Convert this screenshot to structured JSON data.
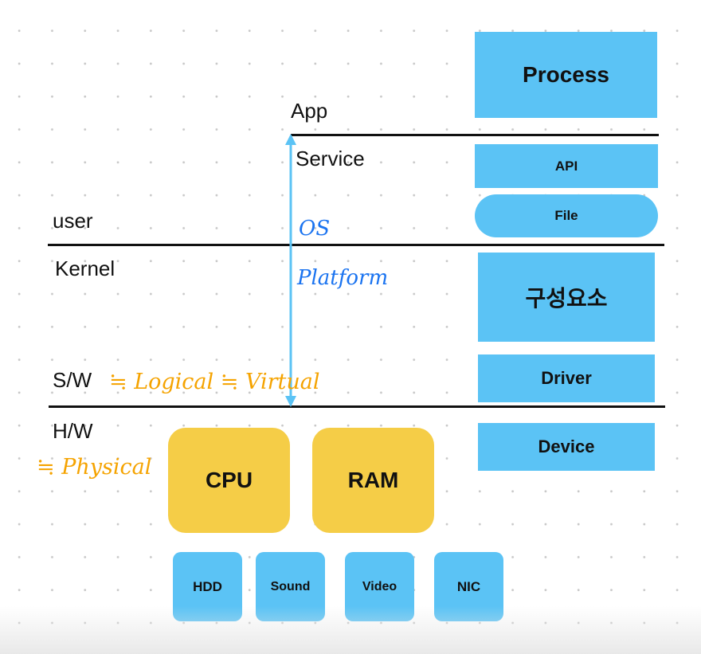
{
  "layers": {
    "app": "App",
    "service": "Service",
    "user": "user",
    "kernel": "Kernel",
    "sw": "S/W",
    "hw": "H/W"
  },
  "annotations": {
    "os": "OS",
    "platform": "Platform",
    "logical": "≒ Logical ≒ Virtual",
    "physical": "≒ Physical"
  },
  "stack": [
    "Process",
    "API",
    "File",
    "구성요소",
    "Driver",
    "Device"
  ],
  "hardware": {
    "main": [
      "CPU",
      "RAM"
    ],
    "devices": [
      "HDD",
      "Sound",
      "Video",
      "NIC"
    ]
  },
  "colors": {
    "blue_box": "#5bc3f5",
    "yellow_box": "#f5cd47",
    "arrow": "#5bc3f5",
    "handwriting_orange": "#f5a300",
    "handwriting_blue": "#1a73f0"
  }
}
